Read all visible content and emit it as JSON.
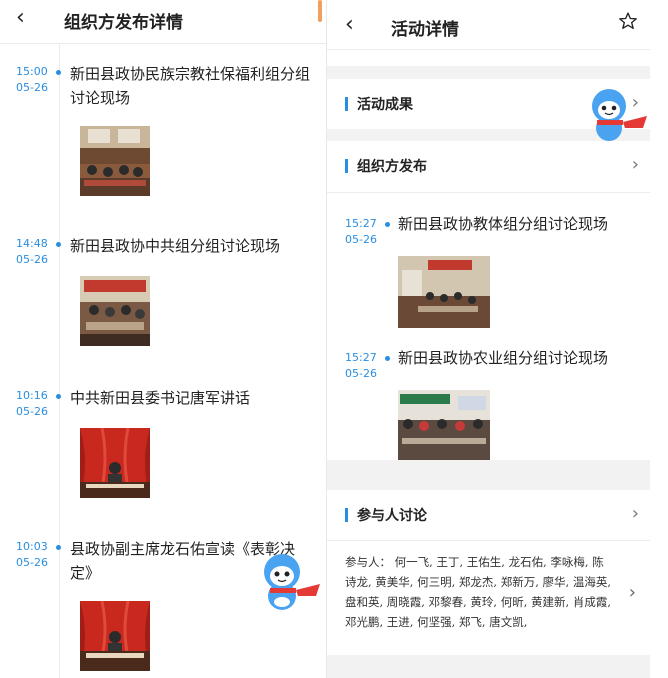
{
  "left": {
    "back_glyph": "‹",
    "title": "组织方发布详情",
    "entries": [
      {
        "time": "15:00",
        "date": "05-26",
        "title": "新田县政协民族宗教社保福利组分组讨论现场"
      },
      {
        "time": "14:48",
        "date": "05-26",
        "title": "新田县政协中共组分组讨论现场"
      },
      {
        "time": "10:16",
        "date": "05-26",
        "title": "中共新田县委书记唐军讲话"
      },
      {
        "time": "10:03",
        "date": "05-26",
        "title": "县政协副主席龙石佑宣读《表彰决定》"
      }
    ]
  },
  "right": {
    "back_glyph": "‹",
    "title": "活动详情",
    "sections": {
      "results": "活动成果",
      "org": "组织方发布",
      "discussion": "参与人讨论"
    },
    "org_entries": [
      {
        "time": "15:27",
        "date": "05-26",
        "title": "新田县政协教体组分组讨论现场"
      },
      {
        "time": "15:27",
        "date": "05-26",
        "title": "新田县政协农业组分组讨论现场"
      }
    ],
    "participants_label": "参与人：",
    "participants": "何一飞, 王丁, 王佑生, 龙石佑, 李咏梅, 陈诗龙, 黄美华, 何三明, 郑龙杰, 郑新万, 廖华, 温海英, 盘和英, 周晓霞, 邓黎春, 黄玲, 何昕, 黄建新, 肖成霞, 邓光鹏, 王进, 何坚强, 郑飞, 唐文凯,"
  },
  "colors": {
    "accent": "#2a8ee0",
    "divider": "#f2f2f2",
    "mascot": "#4aa3f0",
    "scarf": "#e53935"
  }
}
